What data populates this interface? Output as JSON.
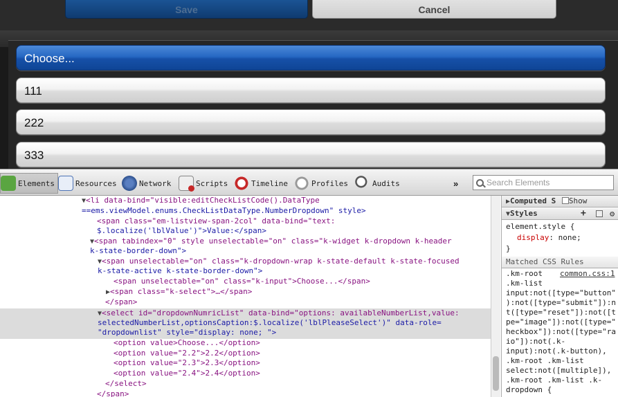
{
  "app": {
    "save_label": "Save",
    "cancel_label": "Cancel",
    "options": [
      "Choose...",
      "111",
      "222",
      "333"
    ]
  },
  "devtools": {
    "tabs": [
      {
        "label": "Elements",
        "icon": "elements-icon"
      },
      {
        "label": "Resources",
        "icon": "resources-icon"
      },
      {
        "label": "Network",
        "icon": "network-icon"
      },
      {
        "label": "Scripts",
        "icon": "scripts-icon"
      },
      {
        "label": "Timeline",
        "icon": "timeline-icon"
      },
      {
        "label": "Profiles",
        "icon": "profiles-icon"
      },
      {
        "label": "Audits",
        "icon": "audits-icon"
      }
    ],
    "more": "»",
    "search_placeholder": "Search Elements",
    "dom": {
      "l1": "<li data-bind=\"visible:editCheckListCode().DataType",
      "l2": "==ems.viewModel.enums.CheckListDataType.NumberDropdown\" style>",
      "l3": "<span class=\"em-listview-span-2col\" data-bind=\"text:",
      "l4": "$.localize('lblValue')\">Value:</span>",
      "l5": "<span tabindex=\"0\" style unselectable=\"on\" class=\"k-widget k-dropdown k-header",
      "l6": "k-state-border-down\">",
      "l7": "<span unselectable=\"on\" class=\"k-dropdown-wrap k-state-default k-state-focused",
      "l8": "k-state-active k-state-border-down\">",
      "l9": "<span unselectable=\"on\" class=\"k-input\">Choose...</span>",
      "l10": "<span class=\"k-select\">…</span>",
      "l11": "</span>",
      "l12": "<select id=\"dropdownNumricList\" data-bind=\"options: availableNumberList,value:",
      "l13": "selectedNumberList,optionsCaption:$.localize('lblPleaseSelect')\" data-role=",
      "l14": "\"dropdownlist\" style=\"display: none; \">",
      "l15": "<option value>Choose...</option>",
      "l16": "<option value=\"2.2\">2.2</option>",
      "l17": "<option value=\"2.3\">2.3</option>",
      "l18": "<option value=\"2.4\">2.4</option>",
      "l19": "</select>",
      "l20": "</span>"
    },
    "sidebar": {
      "computed_label": "Computed S",
      "show_inherited": "Show inherit",
      "styles_label": "Styles",
      "element_style": "element.style {",
      "prop_name": "display",
      "prop_value": ": none;",
      "close_brace": "}",
      "matched_label": "Matched CSS Rules",
      "rule_sel1": ".km-root",
      "rule_link": "common.css:1",
      "rule_lines": [
        ".km-list",
        "input:not([type=\"button\"",
        "):not([type=\"submit\"]):n",
        "t([type=\"reset\"]):not([t",
        "pe=\"image\"]):not([type=\"",
        "heckbox\"]):not([type=\"ra",
        "io\"]):not(.k-",
        "input):not(.k-button),",
        ".km-root .km-list",
        "select:not([multiple]),",
        ".km-root .km-list .k-",
        "dropdown {"
      ]
    }
  }
}
